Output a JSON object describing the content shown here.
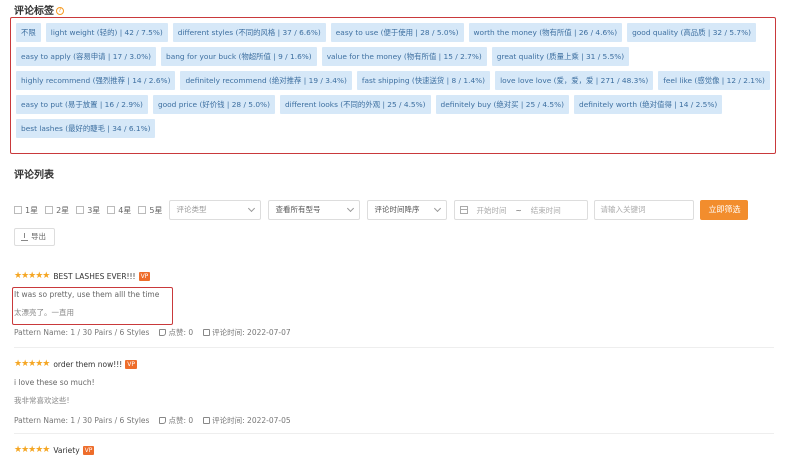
{
  "tags_section": {
    "title": "评论标签",
    "help_icon": "question-circle-icon"
  },
  "tags": [
    [
      "不限",
      "light weight (轻的) | 42 / 7.5%)",
      "different styles (不同的风格 | 37 / 6.6%)",
      "easy to use (便于使用 | 28 / 5.0%)",
      "worth the money (物有所值 | 26 / 4.6%)",
      "good quality (高品质 | 32 / 5.7%)"
    ],
    [
      "easy to apply (容易申请 | 17 / 3.0%)",
      "bang for your buck (物超所值 | 9 / 1.6%)",
      "value for the money (物有所值 | 15 / 2.7%)",
      "great quality (质量上乘 | 31 / 5.5%)"
    ],
    [
      "highly recommend (强烈推荐 | 14 / 2.6%)",
      "definitely recommend (绝对推荐 | 19 / 3.4%)",
      "fast shipping (快速送货 | 8 / 1.4%)",
      "love love love (爱，爱，爱 | 271 / 48.3%)",
      "feel like (感觉像 | 12 / 2.1%)"
    ],
    [
      "easy to put (易于放置 | 16 / 2.9%)",
      "good price (好价钱 | 28 / 5.0%)",
      "different looks (不同的外观 | 25 / 4.5%)",
      "definitely buy (绝对买 | 25 / 4.5%)",
      "definitely worth (绝对值得 | 14 / 2.5%)"
    ],
    [
      "best lashes (最好的睫毛 | 34 / 6.1%)"
    ]
  ],
  "reviews_section": {
    "title": "评论列表"
  },
  "filters": {
    "star_options": [
      "1星",
      "2星",
      "3星",
      "4星",
      "5星"
    ],
    "review_type_placeholder": "评论类型",
    "model_select": "查看所有型号",
    "sort_select": "评论时间降序",
    "start_date_placeholder": "开始时间",
    "date_sep": "~",
    "end_date_placeholder": "结束时间",
    "keyword_placeholder": "请输入关键词",
    "search_button": "立即筛选",
    "export_button": "导出"
  },
  "reviews": [
    {
      "stars": "★★★★★",
      "title": "BEST LASHES EVER!!!",
      "badge": "VP",
      "text": "It was so pretty, use them alll the time",
      "translation": "太漂亮了。一直用",
      "pattern": "Pattern Name: 1 / 30 Pairs / 6 Styles",
      "likes": "点赞: 0",
      "date": "评论时间: 2022-07-07"
    },
    {
      "stars": "★★★★★",
      "title": "order them now!!!",
      "badge": "VP",
      "text": "i love these so much!",
      "translation": "我非常喜欢这些!",
      "pattern": "Pattern Name: 1 / 30 Pairs / 6 Styles",
      "likes": "点赞: 0",
      "date": "评论时间: 2022-07-05"
    },
    {
      "stars": "★★★★★",
      "title": "Variety",
      "badge": "VP"
    }
  ],
  "colors": {
    "accent": "#f28d2d",
    "tag_bg": "#d6e8f8",
    "highlight_border": "#c9393b",
    "star": "#f5a623"
  }
}
